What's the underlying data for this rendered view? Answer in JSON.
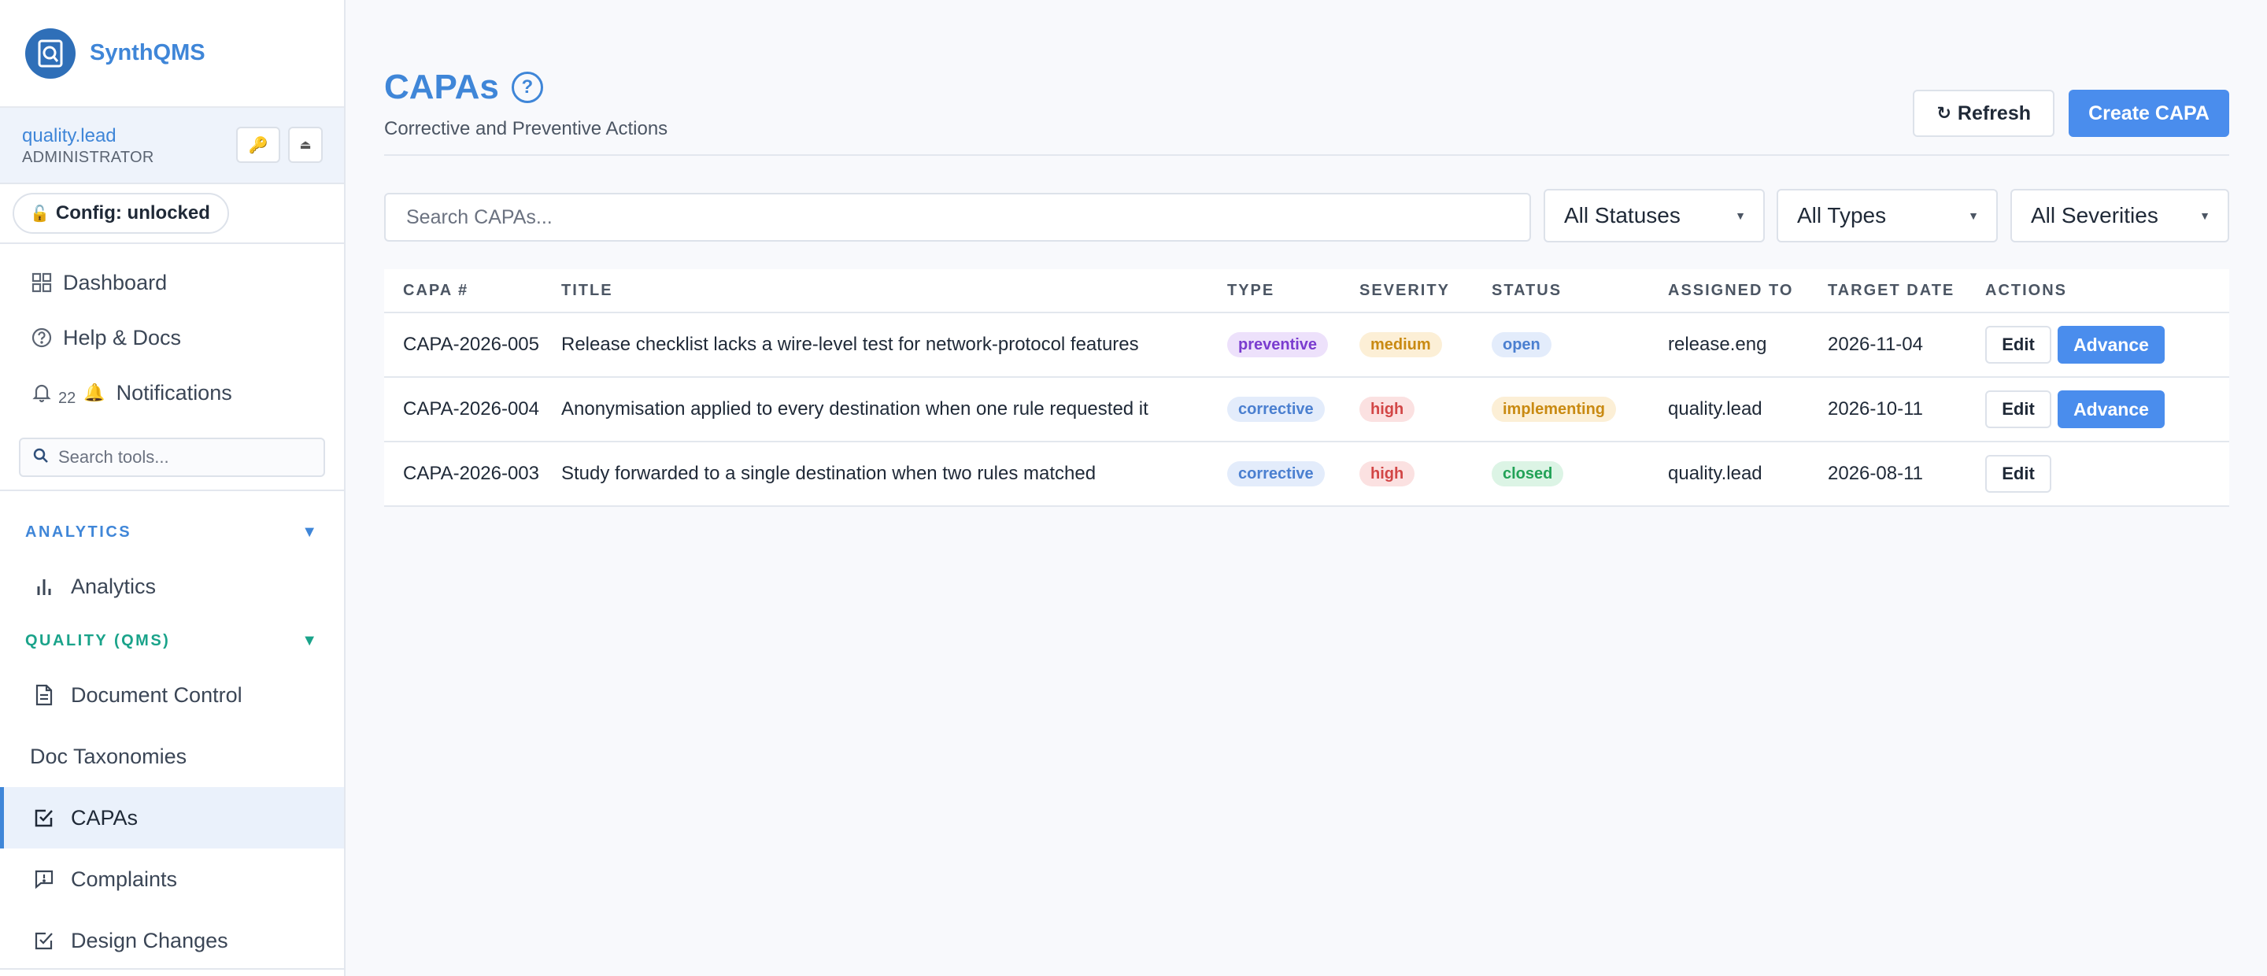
{
  "app": {
    "name": "SynthQMS"
  },
  "user": {
    "name": "quality.lead",
    "role": "ADMINISTRATOR",
    "key_icon": "key-icon",
    "eject_icon": "eject-icon"
  },
  "config": {
    "label": "Config: unlocked",
    "icon": "unlocked-padlock-icon"
  },
  "nav_top": [
    {
      "label": "Dashboard",
      "icon": "grid-icon"
    },
    {
      "label": "Help & Docs",
      "icon": "help-circle-icon"
    },
    {
      "label": "Notifications",
      "icon": "bell-icon",
      "count": "22"
    }
  ],
  "tool_search": {
    "placeholder": "Search tools..."
  },
  "sections": {
    "analytics": {
      "label": "ANALYTICS",
      "items": [
        {
          "label": "Analytics",
          "icon": "bar-chart-icon"
        }
      ]
    },
    "qms": {
      "label": "QUALITY (QMS)",
      "items": [
        {
          "label": "Document Control",
          "icon": "document-icon"
        },
        {
          "label": "Doc Taxonomies",
          "icon": ""
        },
        {
          "label": "CAPAs",
          "icon": "checkbox-icon",
          "active": true
        },
        {
          "label": "Complaints",
          "icon": "alert-message-icon"
        },
        {
          "label": "Design Changes",
          "icon": "checkbox-icon"
        }
      ]
    }
  },
  "page": {
    "title": "CAPAs",
    "subtitle": "Corrective and Preventive Actions",
    "help_glyph": "?",
    "refresh_label": "Refresh",
    "create_label": "Create CAPA"
  },
  "filters": {
    "search_placeholder": "Search CAPAs...",
    "status": "All Statuses",
    "types": "All Types",
    "severities": "All Severities"
  },
  "table": {
    "headers": [
      "CAPA #",
      "TITLE",
      "TYPE",
      "SEVERITY",
      "STATUS",
      "ASSIGNED TO",
      "TARGET DATE",
      "ACTIONS"
    ],
    "edit_label": "Edit",
    "advance_label": "Advance",
    "rows": [
      {
        "id": "CAPA-2026-005",
        "title": "Release checklist lacks a wire-level test for network-protocol features",
        "type": "preventive",
        "severity": "medium",
        "status": "open",
        "assigned": "release.eng",
        "target": "2026-11-04",
        "advance": true
      },
      {
        "id": "CAPA-2026-004",
        "title": "Anonymisation applied to every destination when one rule requested it",
        "type": "corrective",
        "severity": "high",
        "status": "implementing",
        "assigned": "quality.lead",
        "target": "2026-10-11",
        "advance": true
      },
      {
        "id": "CAPA-2026-003",
        "title": "Study forwarded to a single destination when two rules matched",
        "type": "corrective",
        "severity": "high",
        "status": "closed",
        "assigned": "quality.lead",
        "target": "2026-08-11",
        "advance": false
      }
    ]
  },
  "colors": {
    "accent": "#3f86d8",
    "primary_button": "#4a8ded",
    "qms_section": "#1aa38a"
  }
}
